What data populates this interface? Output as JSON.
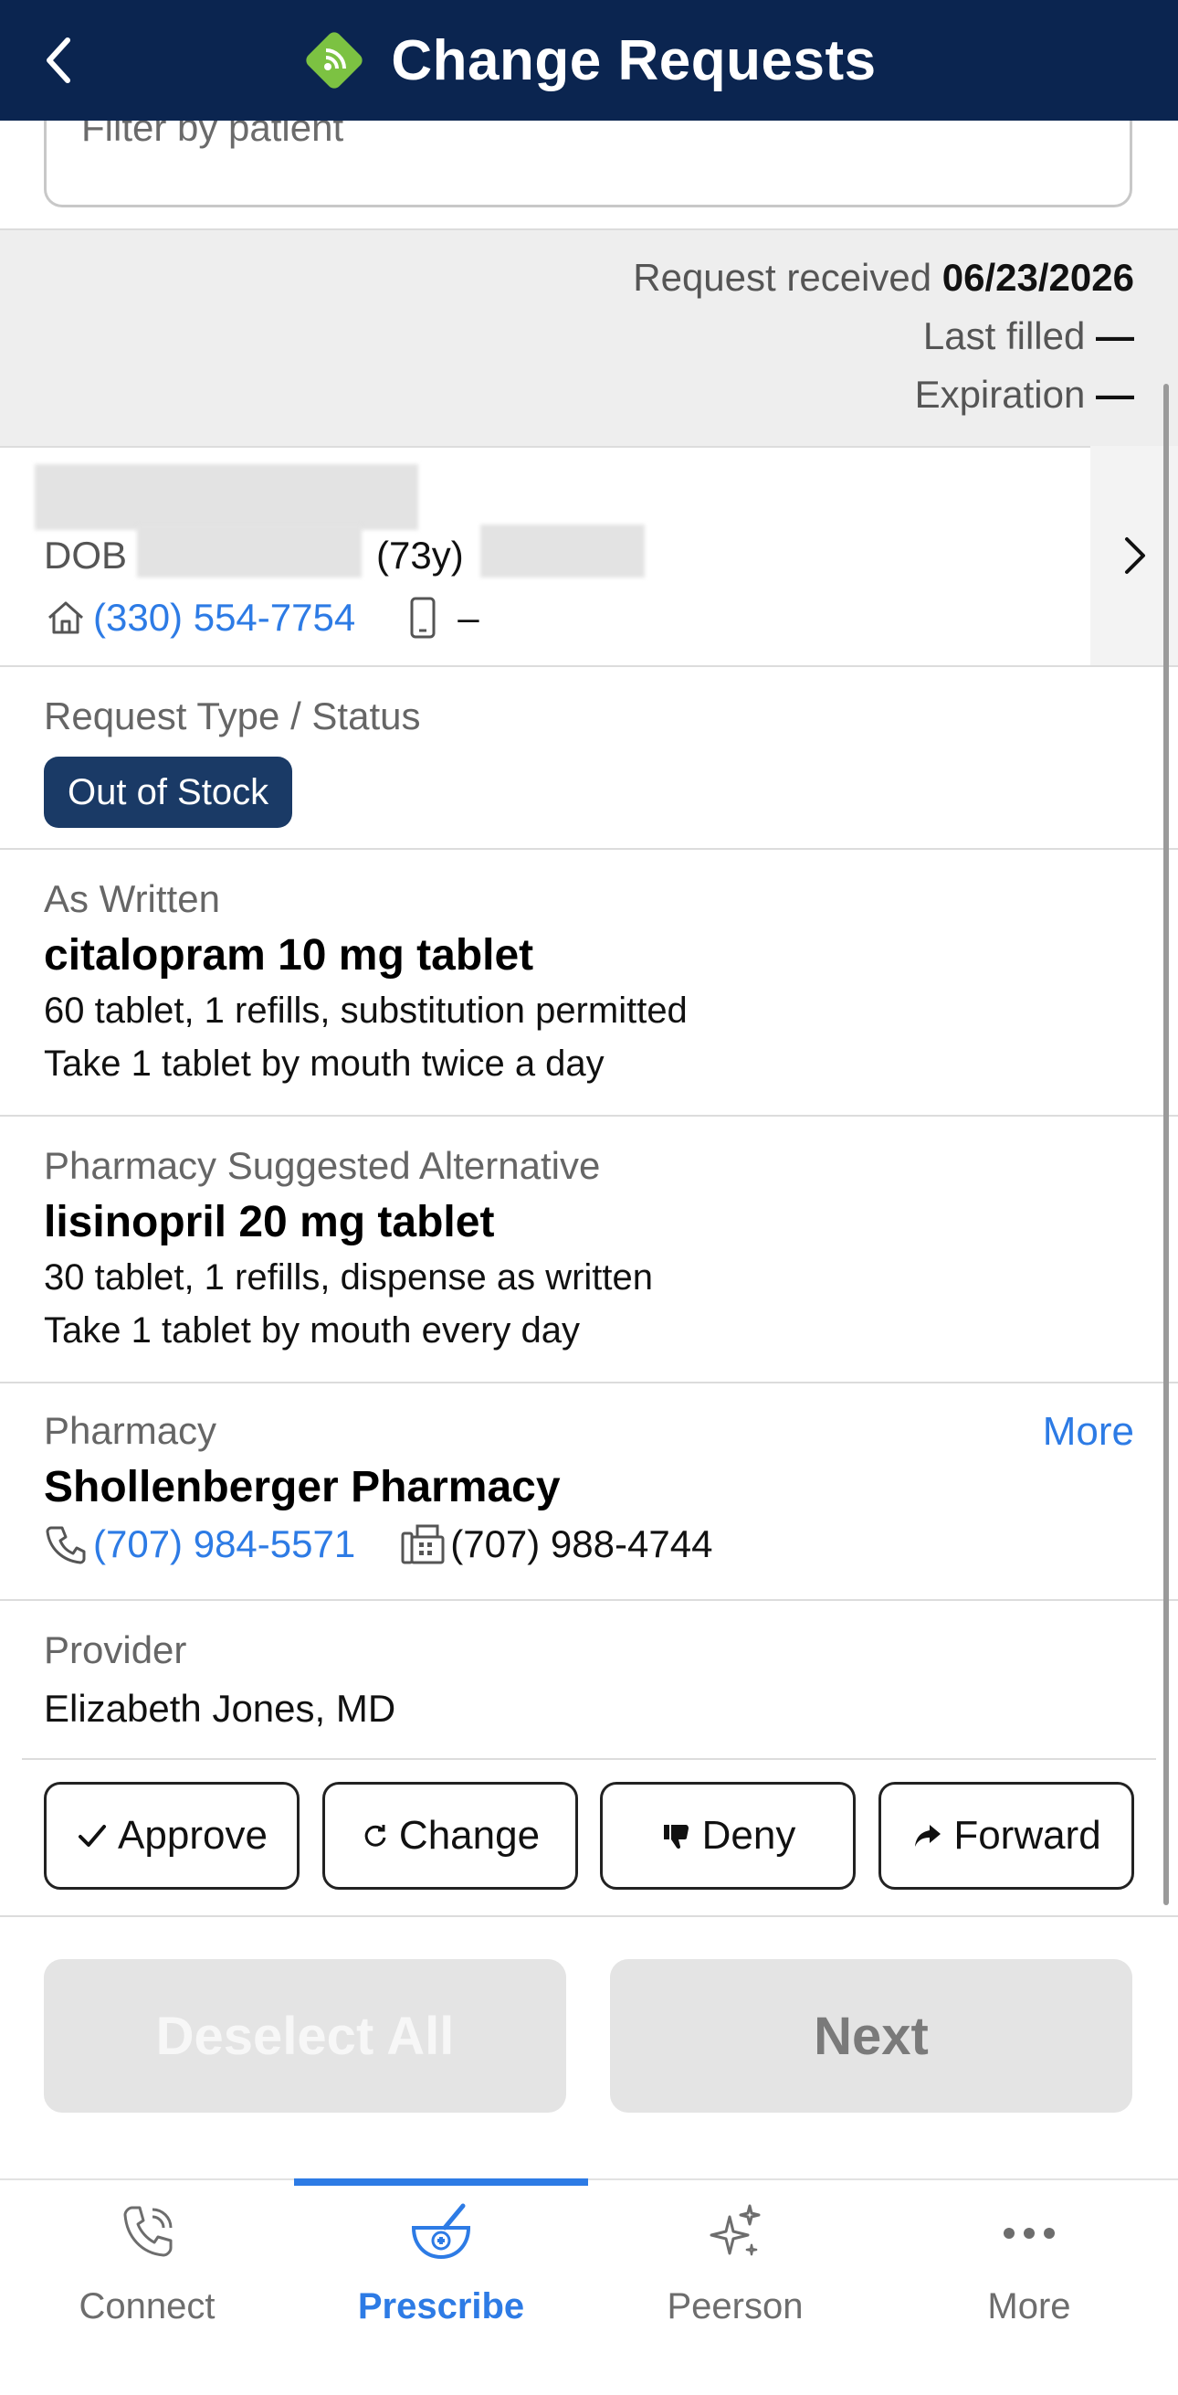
{
  "header": {
    "title": "Change Requests",
    "back_icon": "chevron-left-icon",
    "logo_icon": "rx-signal-logo-icon",
    "brand_color": "#0b2550",
    "accent_color": "#7cc242"
  },
  "filter": {
    "placeholder": "Filter by patient"
  },
  "request_meta": {
    "received_label": "Request received",
    "received_value": "06/23/2026",
    "last_filled_label": "Last filled",
    "last_filled_value": "—",
    "expiration_label": "Expiration",
    "expiration_value": "—"
  },
  "patient": {
    "dob_label": "DOB",
    "age": "(73y)",
    "home_phone": "(330) 554-7754",
    "mobile_phone": "–",
    "home_icon": "home-icon",
    "mobile_icon": "mobile-phone-icon"
  },
  "request_status": {
    "label": "Request Type / Status",
    "badge": "Out of Stock"
  },
  "as_written": {
    "label": "As Written",
    "drug": "citalopram 10 mg tablet",
    "details": "60 tablet, 1 refills, substitution permitted",
    "sig": "Take 1 tablet by mouth twice a day"
  },
  "alternative": {
    "label": "Pharmacy Suggested Alternative",
    "drug": "lisinopril 20 mg tablet",
    "details": "30 tablet, 1 refills, dispense as written",
    "sig": "Take 1 tablet by mouth every day"
  },
  "pharmacy": {
    "label": "Pharmacy",
    "more": "More",
    "name": "Shollenberger Pharmacy",
    "phone": "(707) 984-5571",
    "fax": "(707) 988-4744"
  },
  "provider": {
    "label": "Provider",
    "name": "Elizabeth Jones, MD"
  },
  "actions": {
    "approve": "Approve",
    "change": "Change",
    "deny": "Deny",
    "forward": "Forward"
  },
  "footer_buttons": {
    "deselect_all": "Deselect All",
    "next": "Next"
  },
  "tabs": [
    {
      "label": "Connect",
      "icon": "phone-icon",
      "active": false
    },
    {
      "label": "Prescribe",
      "icon": "mortar-pestle-icon",
      "active": true
    },
    {
      "label": "Peerson",
      "icon": "sparkles-icon",
      "active": false
    },
    {
      "label": "More",
      "icon": "more-dots-icon",
      "active": false
    }
  ],
  "colors": {
    "link": "#2d7be5",
    "badge": "#1a3a66"
  }
}
